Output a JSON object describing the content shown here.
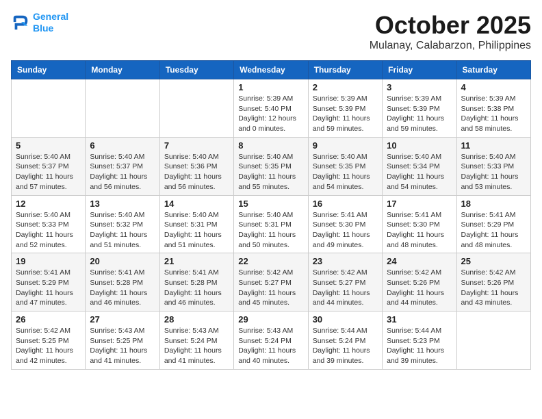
{
  "header": {
    "logo_line1": "General",
    "logo_line2": "Blue",
    "month_title": "October 2025",
    "location": "Mulanay, Calabarzon, Philippines"
  },
  "days_of_week": [
    "Sunday",
    "Monday",
    "Tuesday",
    "Wednesday",
    "Thursday",
    "Friday",
    "Saturday"
  ],
  "weeks": [
    [
      {
        "day": "",
        "info": ""
      },
      {
        "day": "",
        "info": ""
      },
      {
        "day": "",
        "info": ""
      },
      {
        "day": "1",
        "info": "Sunrise: 5:39 AM\nSunset: 5:40 PM\nDaylight: 12 hours\nand 0 minutes."
      },
      {
        "day": "2",
        "info": "Sunrise: 5:39 AM\nSunset: 5:39 PM\nDaylight: 11 hours\nand 59 minutes."
      },
      {
        "day": "3",
        "info": "Sunrise: 5:39 AM\nSunset: 5:39 PM\nDaylight: 11 hours\nand 59 minutes."
      },
      {
        "day": "4",
        "info": "Sunrise: 5:39 AM\nSunset: 5:38 PM\nDaylight: 11 hours\nand 58 minutes."
      }
    ],
    [
      {
        "day": "5",
        "info": "Sunrise: 5:40 AM\nSunset: 5:37 PM\nDaylight: 11 hours\nand 57 minutes."
      },
      {
        "day": "6",
        "info": "Sunrise: 5:40 AM\nSunset: 5:37 PM\nDaylight: 11 hours\nand 56 minutes."
      },
      {
        "day": "7",
        "info": "Sunrise: 5:40 AM\nSunset: 5:36 PM\nDaylight: 11 hours\nand 56 minutes."
      },
      {
        "day": "8",
        "info": "Sunrise: 5:40 AM\nSunset: 5:35 PM\nDaylight: 11 hours\nand 55 minutes."
      },
      {
        "day": "9",
        "info": "Sunrise: 5:40 AM\nSunset: 5:35 PM\nDaylight: 11 hours\nand 54 minutes."
      },
      {
        "day": "10",
        "info": "Sunrise: 5:40 AM\nSunset: 5:34 PM\nDaylight: 11 hours\nand 54 minutes."
      },
      {
        "day": "11",
        "info": "Sunrise: 5:40 AM\nSunset: 5:33 PM\nDaylight: 11 hours\nand 53 minutes."
      }
    ],
    [
      {
        "day": "12",
        "info": "Sunrise: 5:40 AM\nSunset: 5:33 PM\nDaylight: 11 hours\nand 52 minutes."
      },
      {
        "day": "13",
        "info": "Sunrise: 5:40 AM\nSunset: 5:32 PM\nDaylight: 11 hours\nand 51 minutes."
      },
      {
        "day": "14",
        "info": "Sunrise: 5:40 AM\nSunset: 5:31 PM\nDaylight: 11 hours\nand 51 minutes."
      },
      {
        "day": "15",
        "info": "Sunrise: 5:40 AM\nSunset: 5:31 PM\nDaylight: 11 hours\nand 50 minutes."
      },
      {
        "day": "16",
        "info": "Sunrise: 5:41 AM\nSunset: 5:30 PM\nDaylight: 11 hours\nand 49 minutes."
      },
      {
        "day": "17",
        "info": "Sunrise: 5:41 AM\nSunset: 5:30 PM\nDaylight: 11 hours\nand 48 minutes."
      },
      {
        "day": "18",
        "info": "Sunrise: 5:41 AM\nSunset: 5:29 PM\nDaylight: 11 hours\nand 48 minutes."
      }
    ],
    [
      {
        "day": "19",
        "info": "Sunrise: 5:41 AM\nSunset: 5:29 PM\nDaylight: 11 hours\nand 47 minutes."
      },
      {
        "day": "20",
        "info": "Sunrise: 5:41 AM\nSunset: 5:28 PM\nDaylight: 11 hours\nand 46 minutes."
      },
      {
        "day": "21",
        "info": "Sunrise: 5:41 AM\nSunset: 5:28 PM\nDaylight: 11 hours\nand 46 minutes."
      },
      {
        "day": "22",
        "info": "Sunrise: 5:42 AM\nSunset: 5:27 PM\nDaylight: 11 hours\nand 45 minutes."
      },
      {
        "day": "23",
        "info": "Sunrise: 5:42 AM\nSunset: 5:27 PM\nDaylight: 11 hours\nand 44 minutes."
      },
      {
        "day": "24",
        "info": "Sunrise: 5:42 AM\nSunset: 5:26 PM\nDaylight: 11 hours\nand 44 minutes."
      },
      {
        "day": "25",
        "info": "Sunrise: 5:42 AM\nSunset: 5:26 PM\nDaylight: 11 hours\nand 43 minutes."
      }
    ],
    [
      {
        "day": "26",
        "info": "Sunrise: 5:42 AM\nSunset: 5:25 PM\nDaylight: 11 hours\nand 42 minutes."
      },
      {
        "day": "27",
        "info": "Sunrise: 5:43 AM\nSunset: 5:25 PM\nDaylight: 11 hours\nand 41 minutes."
      },
      {
        "day": "28",
        "info": "Sunrise: 5:43 AM\nSunset: 5:24 PM\nDaylight: 11 hours\nand 41 minutes."
      },
      {
        "day": "29",
        "info": "Sunrise: 5:43 AM\nSunset: 5:24 PM\nDaylight: 11 hours\nand 40 minutes."
      },
      {
        "day": "30",
        "info": "Sunrise: 5:44 AM\nSunset: 5:24 PM\nDaylight: 11 hours\nand 39 minutes."
      },
      {
        "day": "31",
        "info": "Sunrise: 5:44 AM\nSunset: 5:23 PM\nDaylight: 11 hours\nand 39 minutes."
      },
      {
        "day": "",
        "info": ""
      }
    ]
  ]
}
